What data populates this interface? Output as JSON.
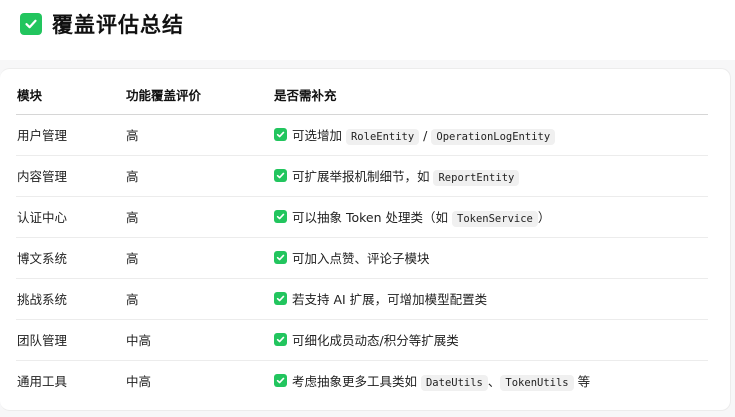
{
  "heading": {
    "icon": "check-box-icon",
    "title": "覆盖评估总结",
    "accent_color": "#22c55e"
  },
  "table": {
    "columns": [
      "模块",
      "功能覆盖评价",
      "是否需补充"
    ],
    "rows": [
      {
        "module": "用户管理",
        "rating": "高",
        "supplement": [
          {
            "t": "text",
            "v": "可选增加 "
          },
          {
            "t": "code",
            "v": "RoleEntity"
          },
          {
            "t": "text",
            "v": " / "
          },
          {
            "t": "code",
            "v": "OperationLogEntity"
          }
        ]
      },
      {
        "module": "内容管理",
        "rating": "高",
        "supplement": [
          {
            "t": "text",
            "v": "可扩展举报机制细节，如 "
          },
          {
            "t": "code",
            "v": "ReportEntity"
          }
        ]
      },
      {
        "module": "认证中心",
        "rating": "高",
        "supplement": [
          {
            "t": "text",
            "v": "可以抽象 Token 处理类（如 "
          },
          {
            "t": "code",
            "v": "TokenService"
          },
          {
            "t": "text",
            "v": "）"
          }
        ]
      },
      {
        "module": "博文系统",
        "rating": "高",
        "supplement": [
          {
            "t": "text",
            "v": "可加入点赞、评论子模块"
          }
        ]
      },
      {
        "module": "挑战系统",
        "rating": "高",
        "supplement": [
          {
            "t": "text",
            "v": "若支持 AI 扩展，可增加模型配置类"
          }
        ]
      },
      {
        "module": "团队管理",
        "rating": "中高",
        "supplement": [
          {
            "t": "text",
            "v": "可细化成员动态/积分等扩展类"
          }
        ]
      },
      {
        "module": "通用工具",
        "rating": "中高",
        "supplement": [
          {
            "t": "text",
            "v": "考虑抽象更多工具类如 "
          },
          {
            "t": "code",
            "v": "DateUtils"
          },
          {
            "t": "text",
            "v": "、"
          },
          {
            "t": "code",
            "v": "TokenUtils"
          },
          {
            "t": "text",
            "v": " 等"
          }
        ]
      }
    ]
  }
}
